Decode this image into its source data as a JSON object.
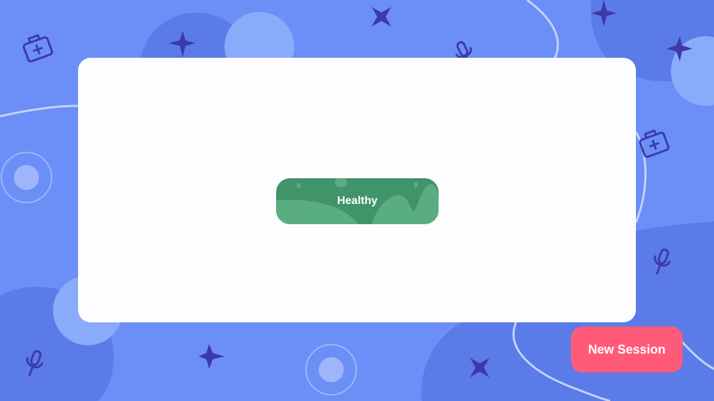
{
  "status": {
    "label": "Healthy"
  },
  "actions": {
    "new_session_label": "New Session"
  },
  "colors": {
    "background": "#6b8ff7",
    "background_blob": "#5a7be8",
    "background_circle": "#8aaafa",
    "decoration_icon": "#3d3aa8",
    "card": "#fdfcfe",
    "status_healthy": "#41946a",
    "status_healthy_light": "#5aad80",
    "new_session_button": "#ff5a78",
    "text_on_color": "#ffffff"
  },
  "icons": {
    "decorations": [
      "medkit-icon",
      "sparkle-icon",
      "microphone-icon",
      "target-circle-icon"
    ]
  }
}
